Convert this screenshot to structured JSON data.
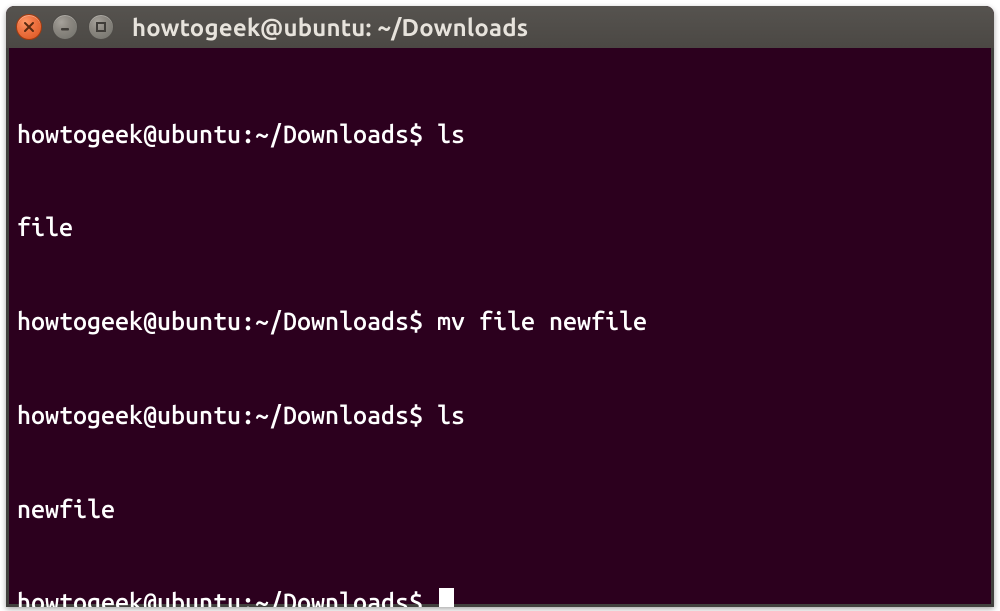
{
  "titlebar": {
    "title": "howtogeek@ubuntu: ~/Downloads"
  },
  "terminal": {
    "lines": [
      {
        "prompt": "howtogeek@ubuntu:~/Downloads$ ",
        "command": "ls"
      },
      {
        "output": "file"
      },
      {
        "prompt": "howtogeek@ubuntu:~/Downloads$ ",
        "command": "mv file newfile"
      },
      {
        "prompt": "howtogeek@ubuntu:~/Downloads$ ",
        "command": "ls"
      },
      {
        "output": "newfile"
      },
      {
        "prompt": "howtogeek@ubuntu:~/Downloads$ ",
        "cursor": true
      }
    ]
  }
}
